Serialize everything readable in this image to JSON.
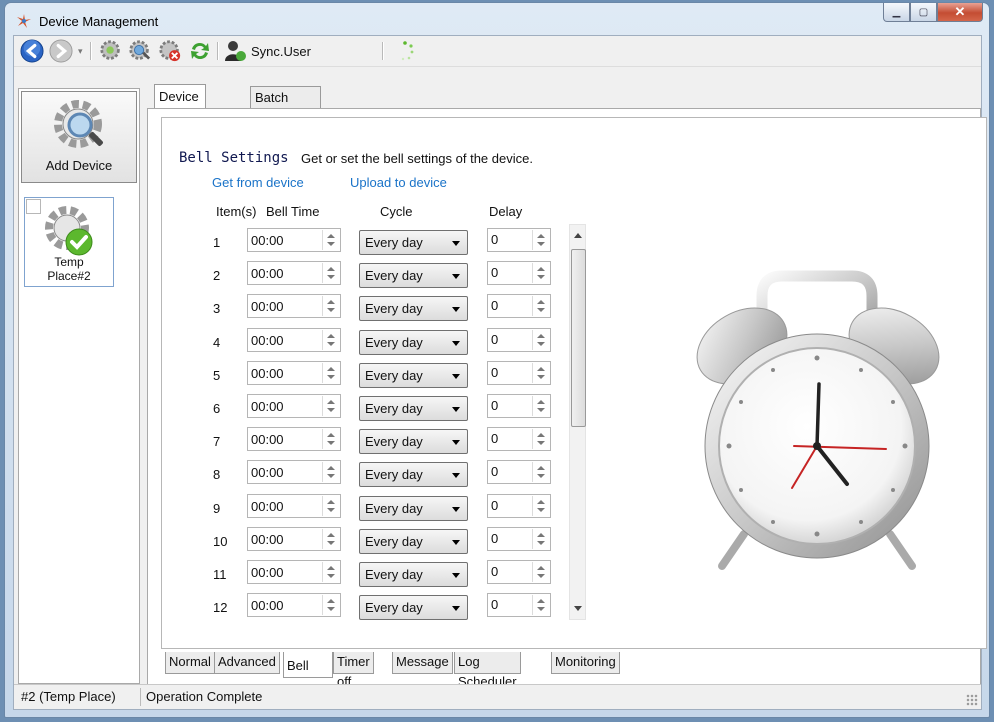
{
  "window": {
    "title": "Device Management"
  },
  "toolbar": {
    "sync_label": "Sync.User"
  },
  "sidebar": {
    "add_device_label": "Add Device",
    "device": {
      "name_line1": "Temp",
      "name_line2": "Place#2"
    }
  },
  "tabs_top": [
    {
      "label": "Device Control",
      "active": true
    },
    {
      "label": "Batch operations",
      "active": false
    }
  ],
  "bell": {
    "heading": "Bell Settings",
    "description": "Get or set the bell settings of the device.",
    "get_link": "Get from device",
    "upload_link": "Upload to device",
    "columns": {
      "item": "Item(s)",
      "time": "Bell Time",
      "cycle": "Cycle",
      "delay": "Delay"
    },
    "rows": [
      {
        "item": "1",
        "time": "00:00",
        "cycle": "Every day",
        "delay": "0"
      },
      {
        "item": "2",
        "time": "00:00",
        "cycle": "Every day",
        "delay": "0"
      },
      {
        "item": "3",
        "time": "00:00",
        "cycle": "Every day",
        "delay": "0"
      },
      {
        "item": "4",
        "time": "00:00",
        "cycle": "Every day",
        "delay": "0"
      },
      {
        "item": "5",
        "time": "00:00",
        "cycle": "Every day",
        "delay": "0"
      },
      {
        "item": "6",
        "time": "00:00",
        "cycle": "Every day",
        "delay": "0"
      },
      {
        "item": "7",
        "time": "00:00",
        "cycle": "Every day",
        "delay": "0"
      },
      {
        "item": "8",
        "time": "00:00",
        "cycle": "Every day",
        "delay": "0"
      },
      {
        "item": "9",
        "time": "00:00",
        "cycle": "Every day",
        "delay": "0"
      },
      {
        "item": "10",
        "time": "00:00",
        "cycle": "Every day",
        "delay": "0"
      },
      {
        "item": "11",
        "time": "00:00",
        "cycle": "Every day",
        "delay": "0"
      },
      {
        "item": "12",
        "time": "00:00",
        "cycle": "Every day",
        "delay": "0"
      }
    ]
  },
  "tabs_bottom": [
    {
      "label": "Normal",
      "active": false
    },
    {
      "label": "Advanced",
      "active": false
    },
    {
      "label": "Bell",
      "active": true
    },
    {
      "label": "Timer off",
      "active": false
    },
    {
      "label": "Message",
      "active": false
    },
    {
      "label": "Log Scheduler",
      "active": false
    },
    {
      "label": "Monitoring",
      "active": false
    }
  ],
  "status": {
    "device": "#2 (Temp Place)",
    "message": "Operation Complete"
  },
  "colors": {
    "link": "#1a73c8",
    "heading": "#101850",
    "accent_green": "#5cb82e",
    "close_red": "#c44d33"
  },
  "icons": [
    "app-icon",
    "back-icon",
    "forward-icon",
    "search-device-icon",
    "refresh-devices-icon",
    "remove-device-icon",
    "sync-icon",
    "user-icon",
    "loading-icon",
    "alarm-clock-illustration"
  ]
}
